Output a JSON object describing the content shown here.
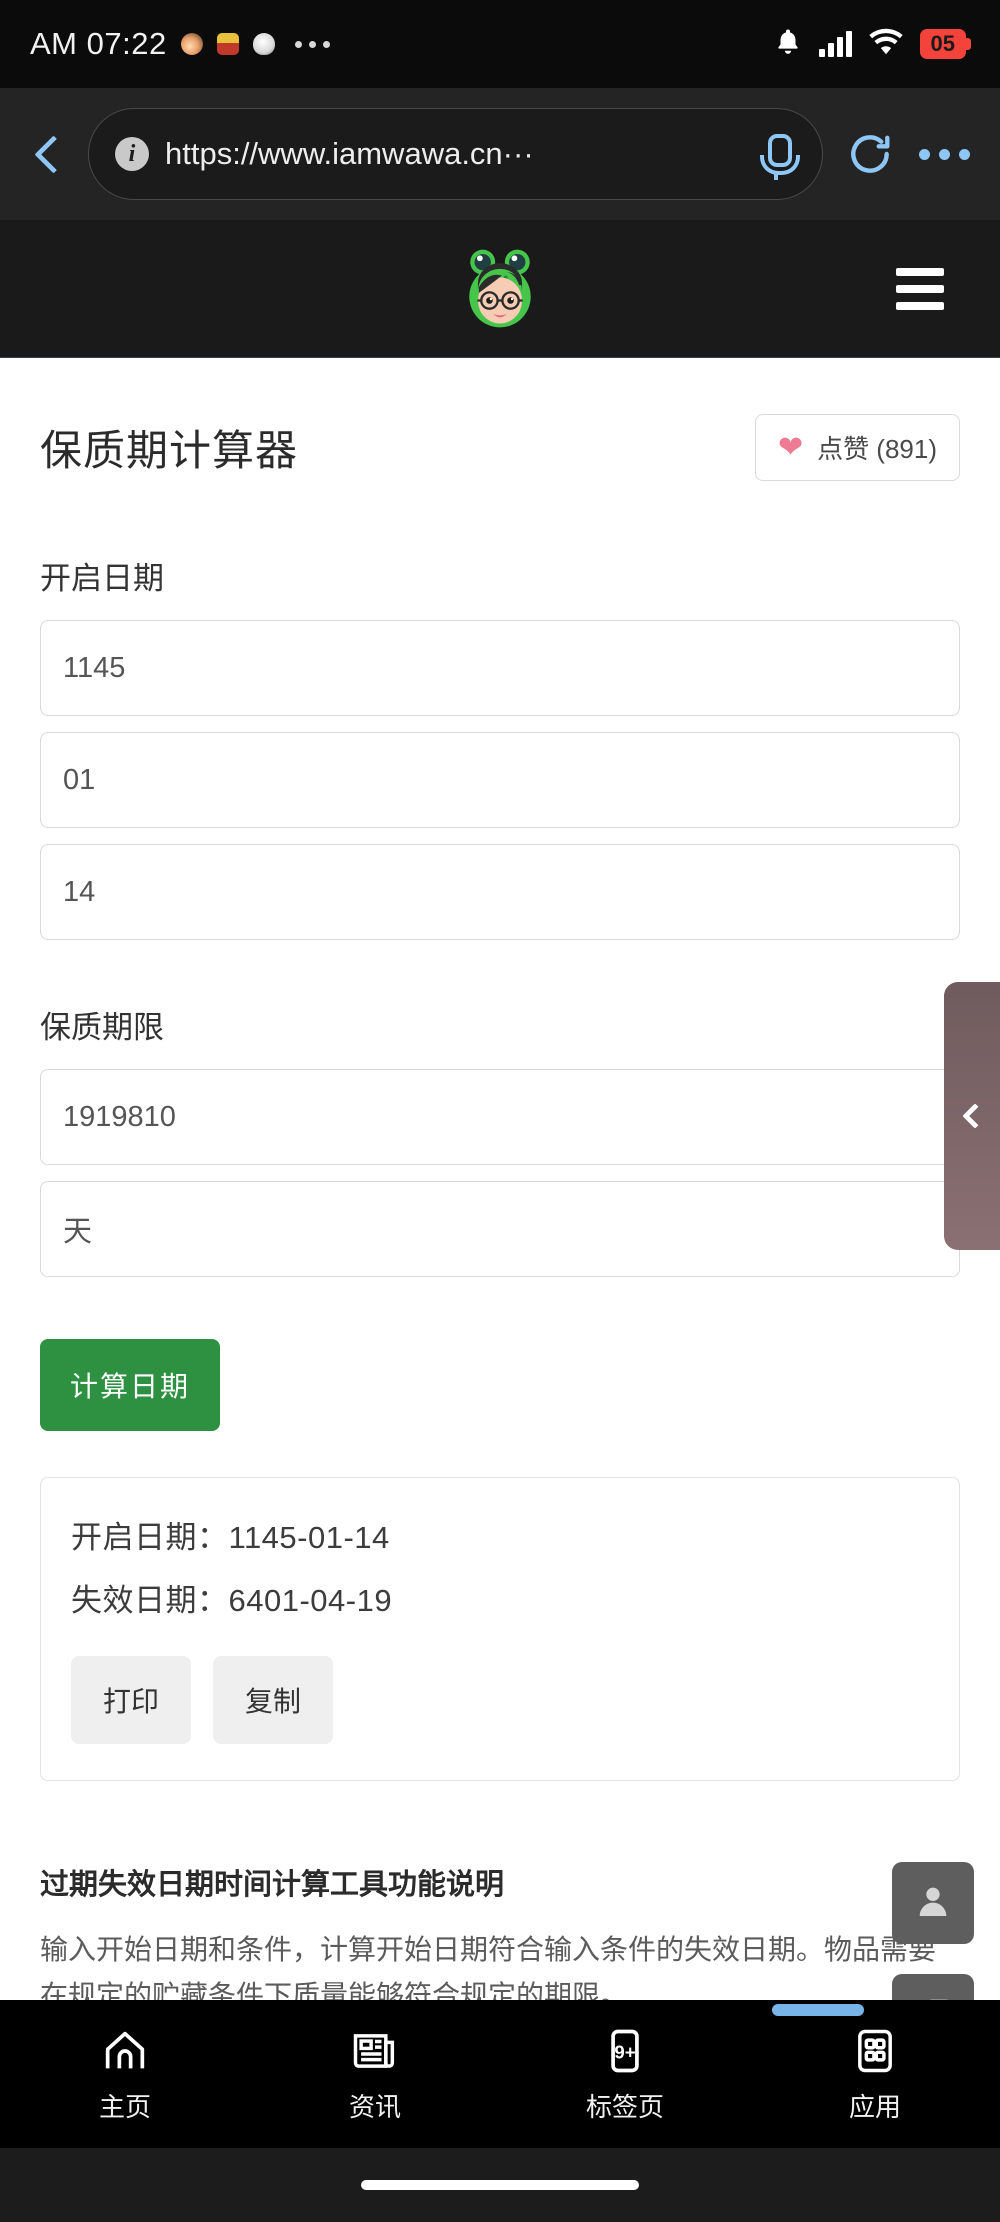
{
  "status_bar": {
    "clock": "AM 07:22",
    "notification_icons": [
      "fire-icon",
      "badge-icon",
      "ghost-icon"
    ],
    "overflow": "more-notifications-icon",
    "bell": "bell-icon",
    "signal": "cellular-signal-icon",
    "wifi": "wifi-icon",
    "battery_level": "05",
    "battery_color": "#f4433a"
  },
  "browser": {
    "back": "back-chevron-icon",
    "site_info": "i",
    "url": "https://www.iamwawa.cn···",
    "mic": "microphone-icon",
    "reload": "reload-icon",
    "more": "more-options-icon",
    "accent_color": "#8ec6f5"
  },
  "site_header": {
    "logo": "frog-girl-logo",
    "menu": "hamburger-menu-icon",
    "background": "#1a1a1a"
  },
  "page": {
    "title": "保质期计算器",
    "like": {
      "icon": "heart-icon",
      "label": "点赞 (891)",
      "color": "#ef7a94"
    }
  },
  "form": {
    "start_date": {
      "label": "开启日期",
      "year": "1145",
      "month": "01",
      "day": "14"
    },
    "shelf_life": {
      "label": "保质期限",
      "amount": "1919810",
      "unit": "天"
    },
    "submit_label": "计算日期",
    "submit_color": "#2e9141"
  },
  "result": {
    "start_line": "开启日期：1145-01-14",
    "expiry_line": "失效日期：6401-04-19",
    "print_label": "打印",
    "copy_label": "复制"
  },
  "description": {
    "heading": "过期失效日期时间计算工具功能说明",
    "body": "输入开始日期和条件，计算开始日期符合输入条件的失效日期。物品需要在规定的贮藏条件下质量能够符合规定的期限。"
  },
  "floating": {
    "side_tab": "collapse-chevron-icon",
    "side_tab_color": "#7a6264",
    "user_button": "user-account-icon",
    "feedback_button": "feedback-chat-icon"
  },
  "bottom_nav": {
    "items": [
      {
        "icon": "home-icon",
        "label": "主页",
        "badge": ""
      },
      {
        "icon": "news-icon",
        "label": "资讯",
        "badge": ""
      },
      {
        "icon": "tabs-icon",
        "label": "标签页",
        "badge": "9+"
      },
      {
        "icon": "apps-icon",
        "label": "应用",
        "badge": ""
      }
    ]
  }
}
